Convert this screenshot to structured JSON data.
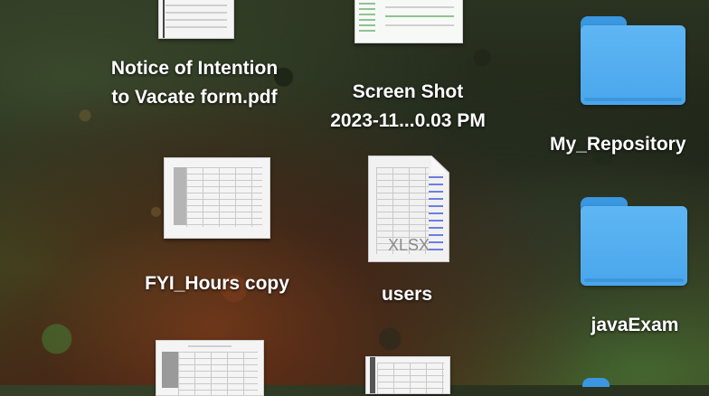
{
  "desktop": {
    "items": [
      {
        "label_lines": [
          "Notice of Intention",
          "to Vacate form.pdf"
        ],
        "kind": "pdf-document"
      },
      {
        "label_lines": [
          "Screen Shot",
          "2023-11...0.03 PM"
        ],
        "kind": "screenshot-image"
      },
      {
        "label_lines": [
          "My_Repository"
        ],
        "kind": "folder"
      },
      {
        "label_lines": [
          "FYI_Hours copy"
        ],
        "kind": "spreadsheet-document"
      },
      {
        "label_lines": [
          "users"
        ],
        "kind": "xlsx-document",
        "badge": "XLSX"
      },
      {
        "label_lines": [
          "javaExam"
        ],
        "kind": "folder"
      },
      {
        "label_lines": [],
        "kind": "spreadsheet-document"
      },
      {
        "label_lines": [],
        "kind": "document"
      },
      {
        "label_lines": [],
        "kind": "folder"
      }
    ]
  },
  "colors": {
    "folder": "#4aa6ec",
    "label_text": "#ffffff"
  }
}
